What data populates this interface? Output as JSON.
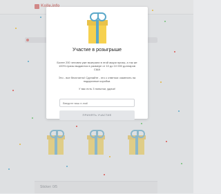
{
  "header": {
    "logo_text": "Kolle.info"
  },
  "background": {
    "left_strip_label": "",
    "right_strip_label": "",
    "bottom_bar_label": "Sticker: 0/5"
  },
  "modal": {
    "title": "Участие в розыгрыше",
    "paragraph1": "Более 200 человек уже выиграли в этой акции призы, а так же 100% призы выдаются в размере от 10 до 10 000 долларов США",
    "paragraph2": "Это - все бесплатно! Сделайте - это с ответом: изменить на подарочные коробки.",
    "paragraph3": "У вас есть 3 попытки, удачи!",
    "email_placeholder": "Введите ваш e-mail",
    "submit_label": "ПРИНЯТЬ УЧАСТИЕ"
  },
  "colors": {
    "accent_red": "#d9534f",
    "gift_yellow": "#f3cf4f",
    "ribbon_blue": "#5aa8c9"
  }
}
